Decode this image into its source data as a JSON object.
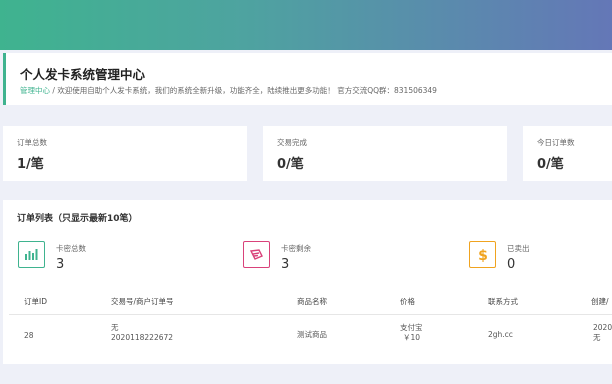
{
  "header": {
    "title": "个人发卡系统管理中心",
    "breadcrumb": "管理中心",
    "separator": "/",
    "welcome": "欢迎使用自助个人发卡系统，我们的系统全新升级，功能齐全，陆续推出更多功能！ 官方交流QQ群：831506349"
  },
  "stats": [
    {
      "label": "订单总数",
      "value": "1/笔"
    },
    {
      "label": "交易完成",
      "value": "0/笔"
    },
    {
      "label": "今日订单数",
      "value": "0/笔"
    }
  ],
  "orders": {
    "title": "订单列表（只显示最新10笔）",
    "summary": [
      {
        "label": "卡密总数",
        "value": "3",
        "icon": "bar-chart-icon",
        "color": "#3fb38f"
      },
      {
        "label": "卡密剩余",
        "value": "3",
        "icon": "card-icon",
        "color": "#d9427a"
      },
      {
        "label": "已卖出",
        "value": "0",
        "icon": "dollar-icon",
        "color": "#f0a31f"
      }
    ],
    "columns": [
      "订单ID",
      "交易号/商户订单号",
      "商品名称",
      "价格",
      "联系方式",
      "创建/"
    ],
    "rows": [
      {
        "id": "28",
        "trade_no": "无",
        "merchant_no": "2020118222672",
        "product": "测试商品",
        "pay_method": "支付宝",
        "price": "￥10",
        "contact": "2gh.cc",
        "created_1": "2020",
        "created_2": "无"
      }
    ]
  }
}
